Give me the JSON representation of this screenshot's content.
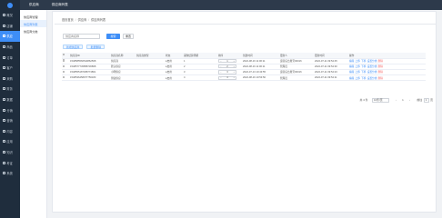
{
  "topbar": {
    "title": "供应商",
    "tab": "供应商列表"
  },
  "sidebar": {
    "items": [
      {
        "label": "概况",
        "active": false
      },
      {
        "label": "店铺",
        "active": false
      },
      {
        "label": "供应",
        "active": true
      },
      {
        "label": "商品",
        "active": false
      },
      {
        "label": "订单",
        "active": false
      },
      {
        "label": "客户",
        "active": false
      },
      {
        "label": "采购",
        "active": false
      },
      {
        "label": "财务",
        "active": false
      },
      {
        "label": "数据",
        "active": false
      },
      {
        "label": "分销",
        "active": false
      },
      {
        "label": "营销",
        "active": false
      },
      {
        "label": "内容",
        "active": false
      },
      {
        "label": "应用",
        "active": false
      },
      {
        "label": "知识",
        "active": false
      },
      {
        "label": "考证",
        "active": false
      },
      {
        "label": "系统",
        "active": false
      }
    ]
  },
  "subnav": {
    "items": [
      {
        "label": "供应商管理",
        "active": false
      },
      {
        "label": "供应商列表",
        "active": true
      },
      {
        "label": "供应商分类",
        "active": false
      }
    ]
  },
  "breadcrumb": [
    "首页首页",
    "供应商",
    "供应商列表"
  ],
  "search": {
    "placeholder": "供应商名称",
    "search_label": "搜索",
    "reset_label": "重置"
  },
  "actions": {
    "add_label": "新增供应商",
    "batch_label": "批量删除"
  },
  "table": {
    "headers": [
      "",
      "供应商ID",
      "供应商名称",
      "供应商类型",
      "状态",
      "采购结算周期",
      "排序",
      "创建时间",
      "更新人",
      "更新时间",
      "操作"
    ],
    "rows": [
      {
        "id": "1548585566543862568",
        "name": "供应商",
        "type": "",
        "status": "●启用",
        "period": "1",
        "sort": "1",
        "created": "2022-08-16 11:06:11",
        "updater": "运营后台账号00016",
        "updated": "2022-07-11 09:54:45"
      },
      {
        "id": "1548577745858736868",
        "name": "默认供应",
        "type": "",
        "status": "●启用",
        "period": "2",
        "sort": "2",
        "created": "2022-08-16 11:06:11",
        "updater": "管理员",
        "updated": "2022-07-11 09:54:30"
      },
      {
        "id": "1548555187368774861",
        "name": "小明供应",
        "type": "",
        "status": "●启用",
        "period": "3",
        "sort": "3",
        "created": "2022-07-13 10:43:55",
        "updater": "运营后台账号00016",
        "updated": "2022-07-11 09:54:23"
      },
      {
        "id": "1548536458977756183",
        "name": "测试供应",
        "type": "",
        "status": "●启用",
        "period": "4",
        "sort": "4",
        "created": "2022-08-16 10:53:50",
        "updater": "管理员",
        "updated": "2022-07-11 09:54:11"
      }
    ],
    "ops": [
      "编辑",
      "上移",
      "下移",
      "设置分类",
      "删除"
    ]
  },
  "pager": {
    "total": "共 4 条",
    "page_size": "10条/页",
    "prev": "‹",
    "page": "1",
    "next": "›",
    "goto_label": "前往",
    "goto_value": "1",
    "goto_suffix": "页"
  }
}
